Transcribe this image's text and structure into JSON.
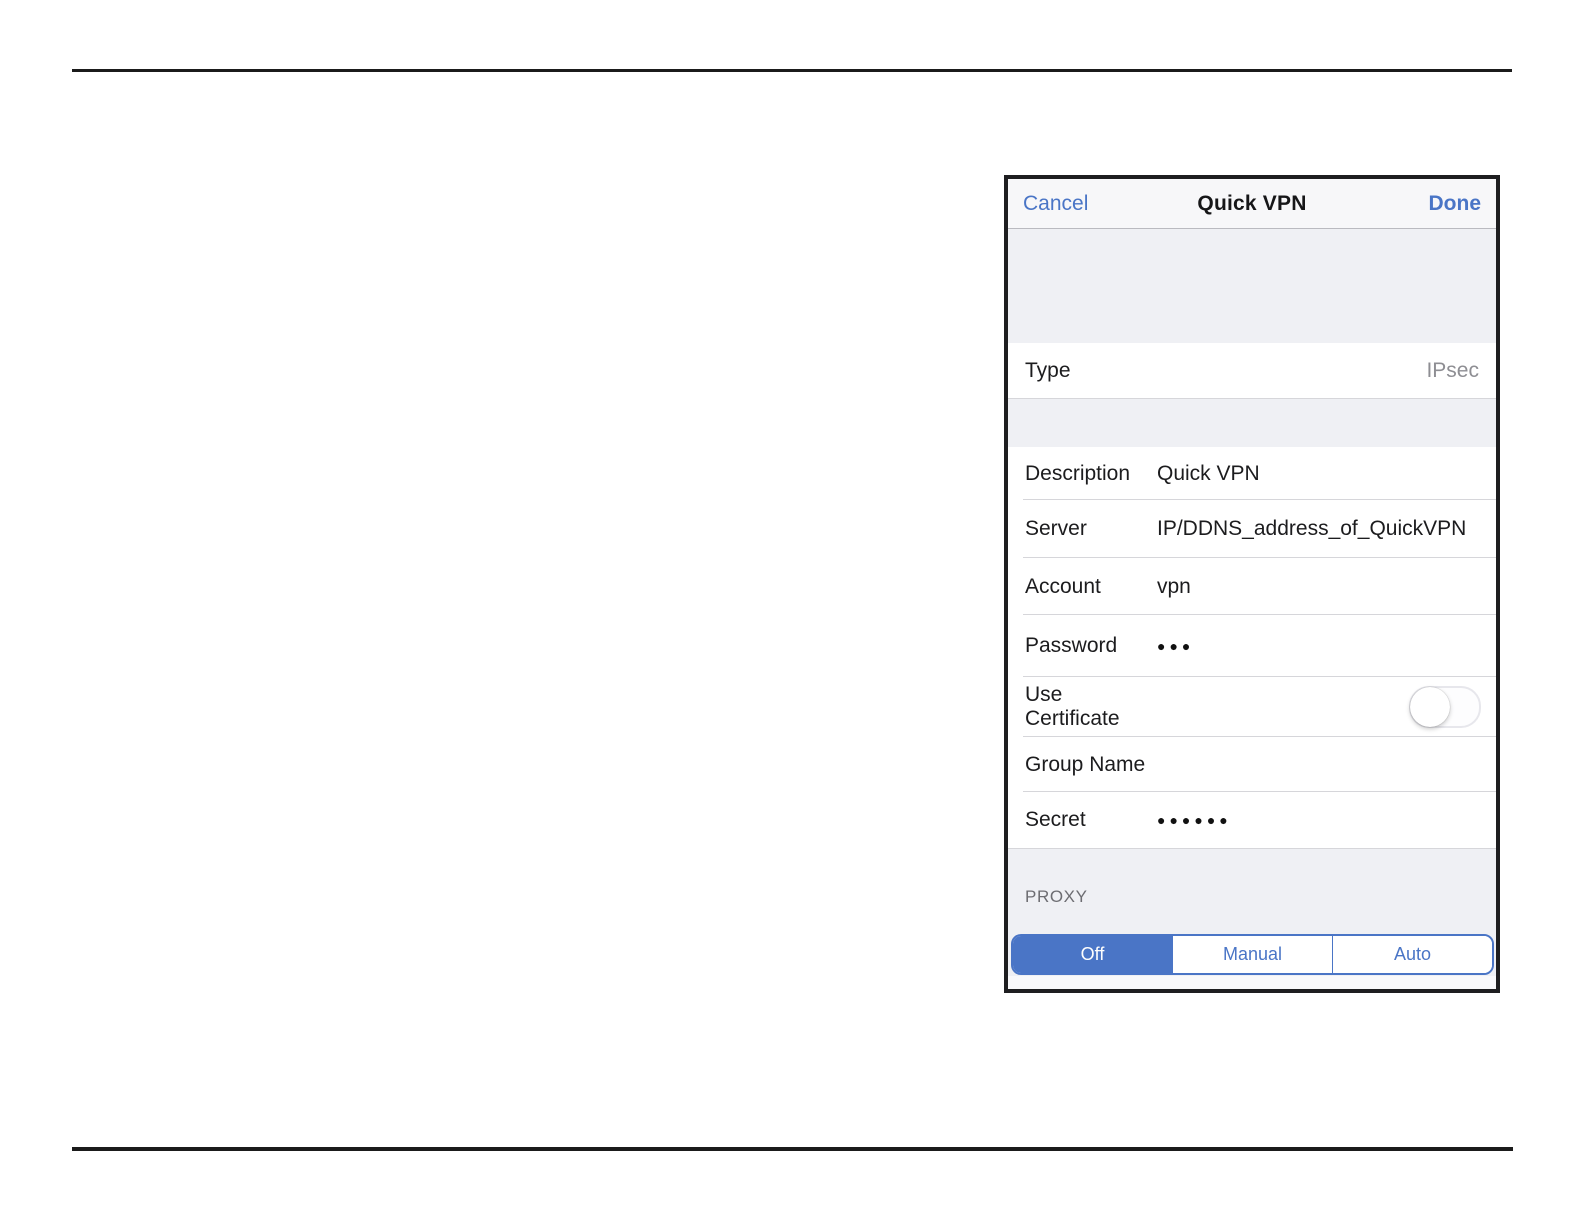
{
  "dialog": {
    "header": {
      "cancel": "Cancel",
      "title": "Quick VPN",
      "done": "Done"
    },
    "type_row": {
      "label": "Type",
      "value": "IPsec"
    },
    "fields": [
      {
        "label": "Description",
        "value": "Quick VPN"
      },
      {
        "label": "Server",
        "value": "IP/DDNS_address_of_QuickVPN"
      },
      {
        "label": "Account",
        "value": "vpn"
      },
      {
        "label": "Password",
        "value": "●●●"
      },
      {
        "label": "Use Certificate",
        "value": ""
      },
      {
        "label": "Group Name",
        "value": ""
      },
      {
        "label": "Secret",
        "value": "●●●●●●"
      }
    ],
    "use_certificate_state": "off",
    "proxy": {
      "label": "PROXY",
      "selected": "Off",
      "options": [
        {
          "label": "Off"
        },
        {
          "label": "Manual"
        },
        {
          "label": "Auto"
        }
      ]
    }
  },
  "colors": {
    "accent_blue": "#4a75c6",
    "value_gray": "#8e8e93",
    "grouped_background": "#eff0f4",
    "frame_border": "#1e1e20",
    "page_rule": "#1b1b1b"
  }
}
